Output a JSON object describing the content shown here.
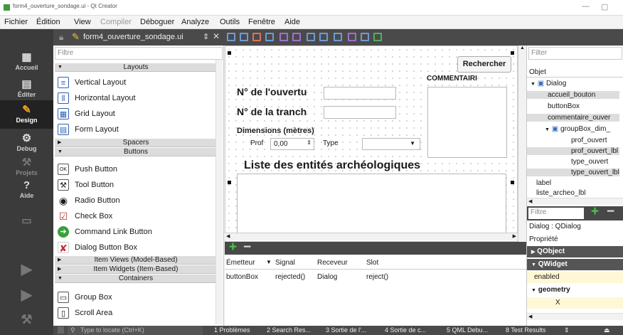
{
  "window": {
    "title": "form4_ouverture_sondage.ui - Qt Creator"
  },
  "menu": [
    "Fichier",
    "Édition",
    "View",
    "Compiler",
    "Déboguer",
    "Analyze",
    "Outils",
    "Fenêtre",
    "Aide"
  ],
  "modes": [
    {
      "label": "Accueil",
      "icon": "grid-icon"
    },
    {
      "label": "Éditer",
      "icon": "document-icon"
    },
    {
      "label": "Design",
      "icon": "pencil-icon"
    },
    {
      "label": "Debug",
      "icon": "bug-icon"
    },
    {
      "label": "Projets",
      "icon": "wrench-icon"
    },
    {
      "label": "Aide",
      "icon": "help-icon"
    }
  ],
  "toolbar": {
    "file_name": "form4_ouverture_sondage.ui"
  },
  "widgetbox": {
    "filter_placeholder": "Filtre",
    "categories": [
      "Layouts",
      "Spacers",
      "Buttons",
      "Item Views (Model-Based)",
      "Item Widgets (Item-Based)",
      "Containers"
    ],
    "items": [
      "Vertical Layout",
      "Horizontal Layout",
      "Grid Layout",
      "Form Layout",
      "Push Button",
      "Tool Button",
      "Radio Button",
      "Check Box",
      "Command Link Button",
      "Dialog Button Box",
      "Group Box",
      "Scroll Area"
    ]
  },
  "form": {
    "search_button": "Rechercher",
    "commentaire_label": "COMMENTAIRI",
    "ouverture_label": "N° de l'ouvertu",
    "tranche_label": "N° de la tranch",
    "dimensions_title": "Dimensions (mètres)",
    "prof_label": "Prof",
    "prof_value": "0,00",
    "type_label": "Type",
    "liste_title": "Liste des entités archéologiques"
  },
  "signals": {
    "headers": [
      "Émetteur",
      "Signal",
      "Receveur",
      "Slot"
    ],
    "rows": [
      [
        "buttonBox",
        "rejected()",
        "Dialog",
        "reject()"
      ]
    ]
  },
  "object_inspector": {
    "filter_placeholder": "Filter",
    "column": "Objet",
    "items": [
      "Dialog",
      "accueil_bouton",
      "buttonBox",
      "commentaire_ouver",
      "groupBox_dim_",
      "prof_ouvert",
      "prof_ouvert_lbl",
      "type_ouvert",
      "type_ouvert_lbl",
      "label",
      "liste_archeo_lbl"
    ]
  },
  "property_editor": {
    "filter_placeholder": "Filtre",
    "context": "Dialog : QDialog",
    "column": "Propriété",
    "rows": [
      "QObject",
      "QWidget",
      "enabled",
      "geometry",
      "X"
    ]
  },
  "statusbar": {
    "locate_placeholder": "Type to locate (Ctrl+K)",
    "tabs": [
      "1 Problèmes",
      "2 Search Res...",
      "3 Sortie de l'...",
      "4 Sortie de c...",
      "5 QML Debu...",
      "8 Test Results"
    ]
  },
  "colors": {
    "accent": "#3c9a3c",
    "sidebar": "#3b3b3b",
    "highlight": "#fff8d6"
  }
}
